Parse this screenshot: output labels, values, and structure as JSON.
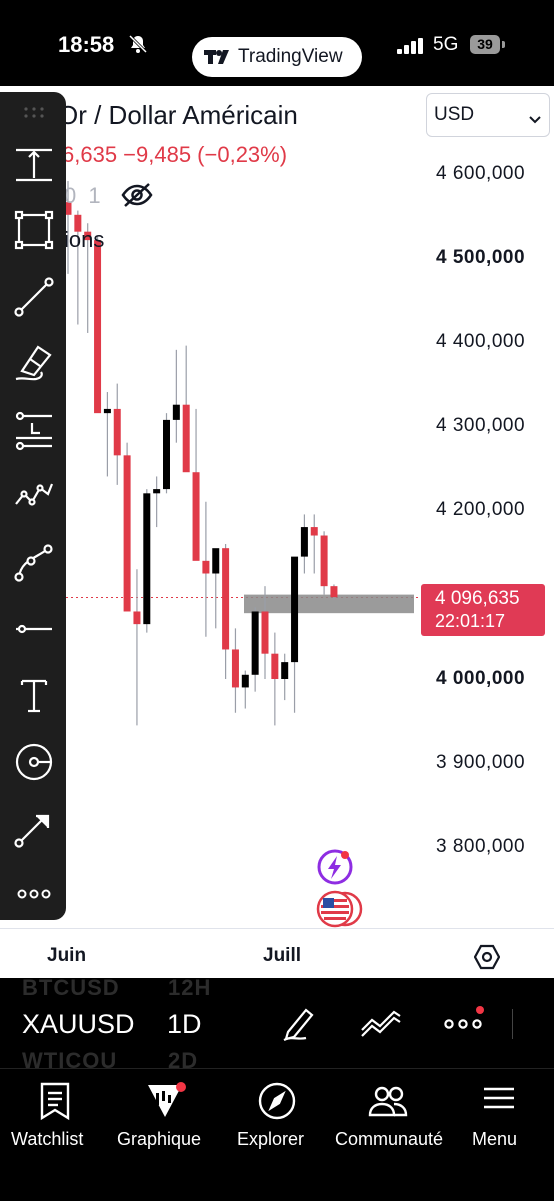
{
  "status_bar": {
    "time": "18:58",
    "app_pill": "TradingView",
    "network": "5G",
    "battery": "39"
  },
  "header": {
    "title": "Or / Dollar Américain",
    "price_change": "6,635 −9,485 (−0,23%)",
    "ohlc_tail": "0 1",
    "events_tail": "ions",
    "currency": "USD"
  },
  "price_axis": {
    "labels": [
      "4 600,000",
      "4 500,000",
      "4 400,000",
      "4 300,000",
      "4 200,000",
      "4 000,000",
      "3 900,000",
      "3 800,000"
    ],
    "current_price": "4 096,635",
    "countdown": "22:01:17"
  },
  "time_axis": {
    "labels": [
      "Juin",
      "Juill"
    ]
  },
  "chart_data": {
    "type": "candlestick",
    "title": "Or / Dollar Américain",
    "ylim": [
      3765,
      4690
    ],
    "up_color": "#000000",
    "down_color": "#e03a48",
    "last_price": 4096.635,
    "candles": [
      {
        "o": 4565,
        "h": 4590,
        "l": 4480,
        "c": 4550
      },
      {
        "o": 4550,
        "h": 4555,
        "l": 4420,
        "c": 4530
      },
      {
        "o": 4530,
        "h": 4540,
        "l": 4410,
        "c": 4520
      },
      {
        "o": 4520,
        "h": 4525,
        "l": 4340,
        "c": 4315
      },
      {
        "o": 4315,
        "h": 4340,
        "l": 4240,
        "c": 4320
      },
      {
        "o": 4320,
        "h": 4350,
        "l": 4230,
        "c": 4265
      },
      {
        "o": 4265,
        "h": 4280,
        "l": 4200,
        "c": 4080
      },
      {
        "o": 4080,
        "h": 4130,
        "l": 3945,
        "c": 4065
      },
      {
        "o": 4065,
        "h": 4225,
        "l": 4055,
        "c": 4220
      },
      {
        "o": 4220,
        "h": 4240,
        "l": 4180,
        "c": 4225
      },
      {
        "o": 4225,
        "h": 4315,
        "l": 4220,
        "c": 4307
      },
      {
        "o": 4307,
        "h": 4390,
        "l": 4280,
        "c": 4325
      },
      {
        "o": 4325,
        "h": 4395,
        "l": 4250,
        "c": 4245
      },
      {
        "o": 4245,
        "h": 4320,
        "l": 4200,
        "c": 4140
      },
      {
        "o": 4140,
        "h": 4210,
        "l": 4050,
        "c": 4125
      },
      {
        "o": 4125,
        "h": 4150,
        "l": 4060,
        "c": 4155
      },
      {
        "o": 4155,
        "h": 4160,
        "l": 4000,
        "c": 4035
      },
      {
        "o": 4035,
        "h": 4060,
        "l": 3960,
        "c": 3990
      },
      {
        "o": 3990,
        "h": 4010,
        "l": 3965,
        "c": 4005
      },
      {
        "o": 4005,
        "h": 4085,
        "l": 3985,
        "c": 4080
      },
      {
        "o": 4080,
        "h": 4110,
        "l": 4000,
        "c": 4030
      },
      {
        "o": 4030,
        "h": 4055,
        "l": 3945,
        "c": 4000
      },
      {
        "o": 4000,
        "h": 4030,
        "l": 3975,
        "c": 4020
      },
      {
        "o": 4020,
        "h": 4125,
        "l": 3960,
        "c": 4145
      },
      {
        "o": 4145,
        "h": 4195,
        "l": 4125,
        "c": 4180
      },
      {
        "o": 4180,
        "h": 4195,
        "l": 4125,
        "c": 4170
      },
      {
        "o": 4170,
        "h": 4175,
        "l": 4100,
        "c": 4110
      },
      {
        "o": 4110,
        "h": 4112,
        "l": 4094,
        "c": 4097
      }
    ],
    "zone": {
      "low": 4078,
      "high": 4100
    }
  },
  "toolbar": {
    "tools": [
      "measure-icon",
      "rectangle-icon",
      "trend-line-icon",
      "brush-icon",
      "fib-retracement-icon",
      "pattern-icon",
      "path-icon",
      "horizontal-line-icon",
      "text-icon",
      "prediction-icon",
      "arrow-icon",
      "more-tools-icon"
    ]
  },
  "bottom": {
    "ghost_prev_symbol": "BTCUSD",
    "ghost_prev_interval": "12H",
    "symbol": "XAUUSD",
    "interval": "1D",
    "ghost_next_symbol": "WTICOU",
    "ghost_next_interval": "2D"
  },
  "nav": {
    "items": [
      "Watchlist",
      "Graphique",
      "Explorer",
      "Communauté",
      "Menu"
    ]
  },
  "colors": {
    "accent_red": "#e03a48",
    "label_red": "#e03a55",
    "badge_dot": "#f23645"
  }
}
